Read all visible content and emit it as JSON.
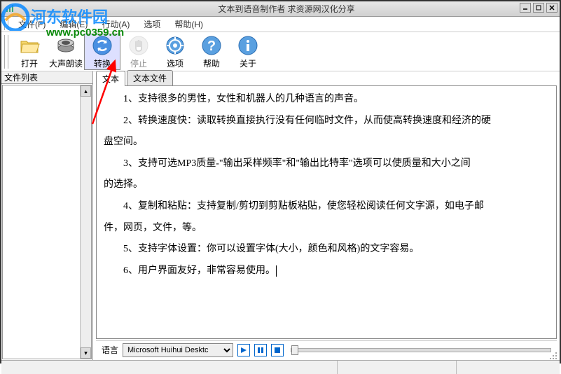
{
  "window": {
    "title": "文本到语音制作者 求资源网汉化分享"
  },
  "menu": {
    "file": "文件(F)",
    "edit": "编辑(E)",
    "action": "行动(A)",
    "options": "选项",
    "help": "帮助(H)"
  },
  "toolbar": {
    "open": "打开",
    "read_aloud": "大声朗读",
    "convert": "转换",
    "stop": "停止",
    "options": "选项",
    "help": "帮助",
    "about": "关于"
  },
  "sidebar": {
    "header": "文件列表"
  },
  "tabs": {
    "text": "文本",
    "text_file": "文本文件"
  },
  "content": {
    "p1": "1、支持很多的男性，女性和机器人的几种语言的声音。",
    "p2": "2、转换速度快：读取转换直接执行没有任何临时文件，从而使高转换速度和经济的硬",
    "p2b": "盘空间。",
    "p3": "3、支持可选MP3质量-\"输出采样频率\"和\"输出比特率\"选项可以使质量和大小之间",
    "p3b": "的选择。",
    "p4": "4、复制和粘贴：支持复制/剪切到剪贴板粘贴，使您轻松阅读任何文字源，如电子邮",
    "p4b": "件，网页，文件，等。",
    "p5": "5、支持字体设置：你可以设置字体(大小，颜色和风格)的文字容易。",
    "p6": "6、用户界面友好，非常容易使用。"
  },
  "bottom": {
    "language_label": "语言",
    "voice_selected": "Microsoft Huihui Desktc"
  },
  "watermark": {
    "url": "www.pc0359.cn"
  }
}
